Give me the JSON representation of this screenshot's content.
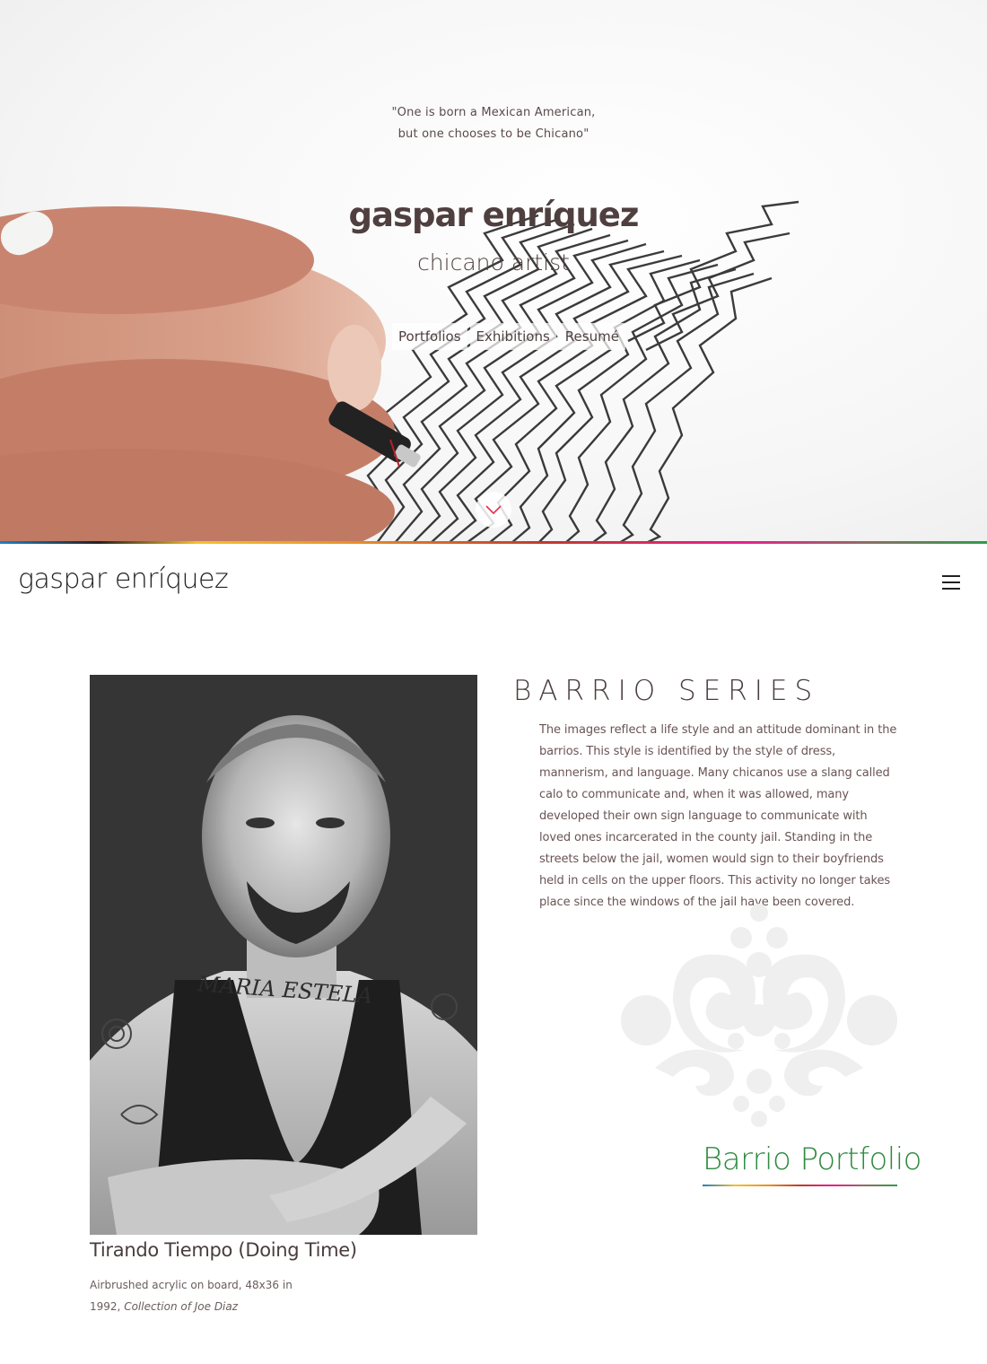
{
  "hero": {
    "quote_line1": "\"One is born a Mexican American,",
    "quote_line2": "but one chooses to be Chicano\"",
    "title": "gaspar enríquez",
    "subtitle": "chicano artist",
    "nav": [
      "Portfolios",
      "Exhibitions",
      "Resumé"
    ],
    "scroll_icon": "chevron-down-icon"
  },
  "header": {
    "brand": "gaspar enríquez",
    "menu_icon": "hamburger-menu-icon"
  },
  "artwork": {
    "title": "Tirando Tiempo (Doing Time)",
    "medium": "Airbrushed acrylic on board,  48x36 in",
    "year": "1992,",
    "collection": "Collection of Joe Diaz"
  },
  "series": {
    "title": "BARRIO SERIES",
    "description": "The images reflect a life style and an attitude dominant in the barrios. This style is identified by the style of dress, mannerism, and language. Many chicanos use a slang called calo to communicate and, when it was allowed, many developed their own sign language to communicate with loved ones incarcerated in the county jail. Standing in the streets below the jail, women would sign to their boyfriends held in cells on the upper floors. This activity no longer takes place since the windows of the jail have been covered.",
    "portfolio_link": "Barrio Portfolio"
  },
  "colors": {
    "accent_green": "#2e8b3f",
    "text_brown": "#4a3c3c",
    "chevron_red": "#e0334a"
  }
}
